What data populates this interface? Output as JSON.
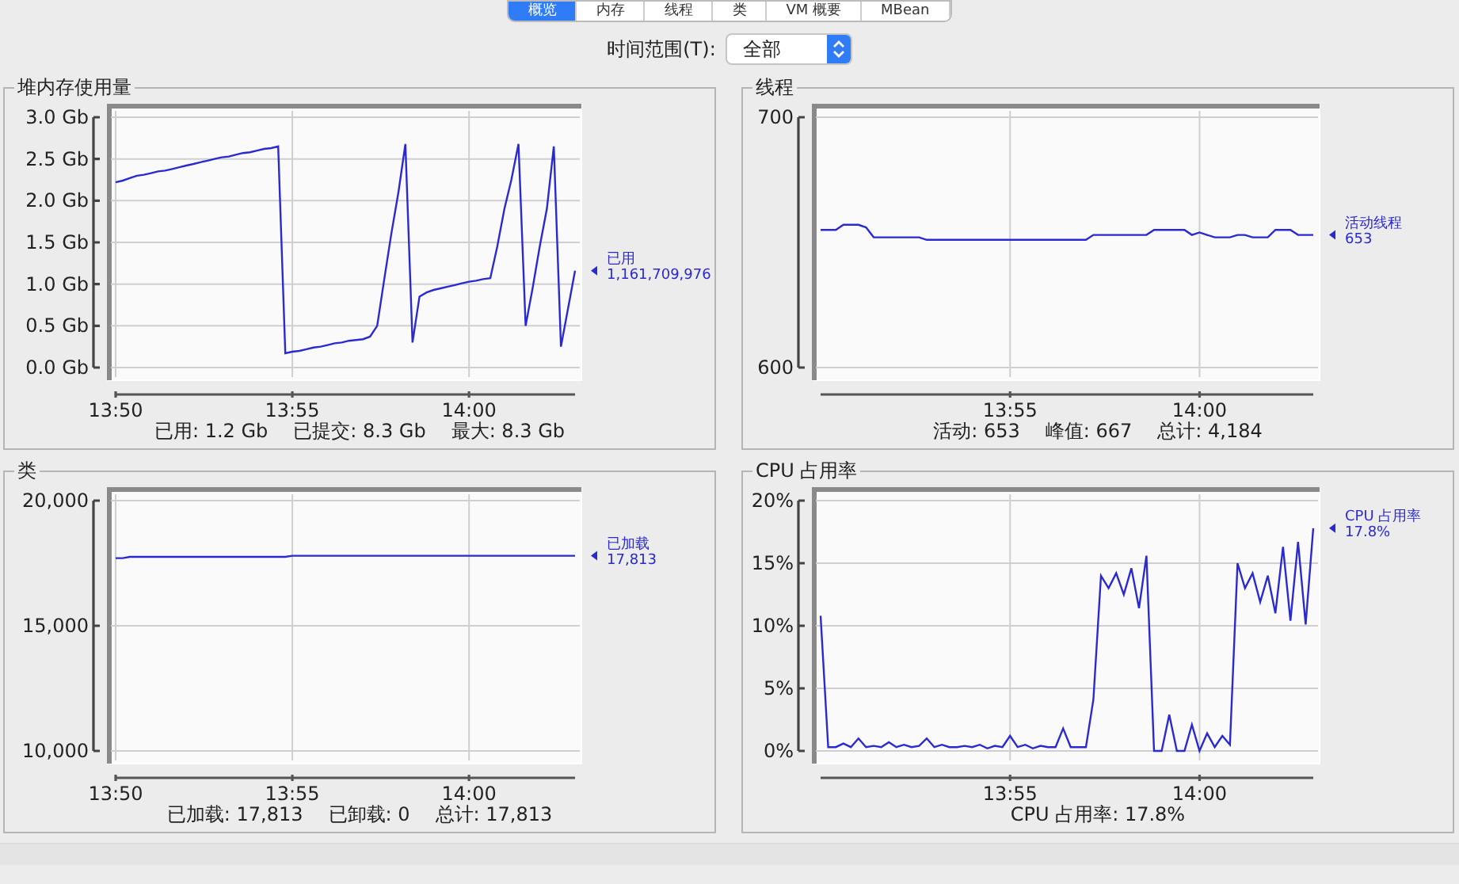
{
  "tabs": [
    {
      "label": "概览",
      "selected": true
    },
    {
      "label": "内存",
      "selected": false
    },
    {
      "label": "线程",
      "selected": false
    },
    {
      "label": "类",
      "selected": false
    },
    {
      "label": "VM 概要",
      "selected": false
    },
    {
      "label": "MBean",
      "selected": false
    }
  ],
  "time_range": {
    "label": "时间范围(T):",
    "value": "全部"
  },
  "panels": [
    {
      "title": "堆内存使用量",
      "legend": {
        "value": "1,161,709,976"
      },
      "summary": [
        "已用: 1.2 Gb",
        "已提交: 8.3 Gb",
        "最大: 8.3 Gb"
      ],
      "chart_data": {
        "type": "line",
        "categories": [
          "13:50",
          null,
          null,
          null,
          null,
          null,
          null,
          null,
          null,
          null,
          null,
          null,
          null,
          null,
          null,
          null,
          null,
          null,
          null,
          null,
          null,
          null,
          null,
          null,
          null,
          "13:55",
          null,
          null,
          null,
          null,
          null,
          null,
          null,
          null,
          null,
          null,
          null,
          null,
          null,
          null,
          null,
          null,
          null,
          null,
          null,
          null,
          null,
          null,
          null,
          null,
          "14:00",
          null,
          null,
          null,
          null,
          null,
          null,
          null,
          null,
          null,
          null,
          null,
          null,
          null,
          null,
          null
        ],
        "series": [
          {
            "name": "已用",
            "color": "#2a2ad0",
            "values": [
              2.22,
              2.24,
              2.27,
              2.3,
              2.31,
              2.33,
              2.35,
              2.36,
              2.38,
              2.4,
              2.42,
              2.44,
              2.46,
              2.48,
              2.5,
              2.52,
              2.53,
              2.55,
              2.57,
              2.58,
              2.6,
              2.62,
              2.63,
              2.65,
              0.17,
              0.19,
              0.2,
              0.22,
              0.24,
              0.25,
              0.27,
              0.29,
              0.3,
              0.32,
              0.33,
              0.34,
              0.37,
              0.5,
              1.05,
              1.6,
              2.1,
              2.68,
              0.3,
              0.85,
              0.9,
              0.93,
              0.95,
              0.97,
              0.99,
              1.01,
              1.03,
              1.04,
              1.06,
              1.07,
              1.45,
              1.9,
              2.25,
              2.68,
              0.5,
              0.95,
              1.45,
              1.9,
              2.65,
              0.25,
              0.7,
              1.16
            ]
          }
        ],
        "ylim": [
          0,
          3
        ],
        "grid": true,
        "yticks": [
          {
            "value": 0,
            "label": "0.0 Gb"
          },
          {
            "value": 0.5,
            "label": "0.5 Gb"
          },
          {
            "value": 1,
            "label": "1.0 Gb"
          },
          {
            "value": 1.5,
            "label": "1.5 Gb"
          },
          {
            "value": 2,
            "label": "2.0 Gb"
          },
          {
            "value": 2.5,
            "label": "2.5 Gb"
          },
          {
            "value": 3,
            "label": "3.0 Gb"
          }
        ]
      }
    },
    {
      "title": "线程",
      "legend": {
        "value": "653"
      },
      "summary": [
        "活动: 653",
        "峰值: 667",
        "总计: 4,184"
      ],
      "chart_data": {
        "type": "line",
        "categories": [
          null,
          null,
          null,
          null,
          null,
          null,
          null,
          null,
          null,
          null,
          null,
          null,
          null,
          null,
          null,
          null,
          null,
          null,
          null,
          null,
          null,
          null,
          null,
          null,
          null,
          "13:55",
          null,
          null,
          null,
          null,
          null,
          null,
          null,
          null,
          null,
          null,
          null,
          null,
          null,
          null,
          null,
          null,
          null,
          null,
          null,
          null,
          null,
          null,
          null,
          null,
          "14:00",
          null,
          null,
          null,
          null,
          null,
          null,
          null,
          null,
          null,
          null,
          null,
          null,
          null,
          null,
          null
        ],
        "series": [
          {
            "name": "活动线程",
            "color": "#2a2ad0",
            "values": [
              655,
              655,
              655,
              657,
              657,
              657,
              656,
              652,
              652,
              652,
              652,
              652,
              652,
              652,
              651,
              651,
              651,
              651,
              651,
              651,
              651,
              651,
              651,
              651,
              651,
              651,
              651,
              651,
              651,
              651,
              651,
              651,
              651,
              651,
              651,
              651,
              653,
              653,
              653,
              653,
              653,
              653,
              653,
              653,
              655,
              655,
              655,
              655,
              655,
              653,
              654,
              653,
              652,
              652,
              652,
              653,
              653,
              652,
              652,
              652,
              655,
              655,
              655,
              653,
              653,
              653
            ]
          }
        ],
        "ylim": [
          600,
          700
        ],
        "grid": true,
        "yticks": [
          {
            "value": 600,
            "label": "600"
          },
          {
            "value": 700,
            "label": "700"
          }
        ]
      }
    },
    {
      "title": "类",
      "legend": {
        "value": "17,813"
      },
      "summary": [
        "已加载: 17,813",
        "已卸载: 0",
        "总计: 17,813"
      ],
      "chart_data": {
        "type": "line",
        "categories": [
          "13:50",
          null,
          null,
          null,
          null,
          null,
          null,
          null,
          null,
          null,
          null,
          null,
          null,
          null,
          null,
          null,
          null,
          null,
          null,
          null,
          null,
          null,
          null,
          null,
          null,
          "13:55",
          null,
          null,
          null,
          null,
          null,
          null,
          null,
          null,
          null,
          null,
          null,
          null,
          null,
          null,
          null,
          null,
          null,
          null,
          null,
          null,
          null,
          null,
          null,
          null,
          "14:00",
          null,
          null,
          null,
          null,
          null,
          null,
          null,
          null,
          null,
          null,
          null,
          null,
          null,
          null,
          null
        ],
        "series": [
          {
            "name": "已加载",
            "color": "#2a2ad0",
            "values": [
              17700,
              17700,
              17750,
              17750,
              17750,
              17750,
              17750,
              17750,
              17750,
              17750,
              17750,
              17750,
              17750,
              17750,
              17750,
              17750,
              17750,
              17750,
              17750,
              17750,
              17750,
              17750,
              17750,
              17750,
              17750,
              17800,
              17800,
              17800,
              17800,
              17800,
              17800,
              17800,
              17800,
              17800,
              17800,
              17800,
              17800,
              17800,
              17800,
              17800,
              17800,
              17800,
              17800,
              17800,
              17800,
              17800,
              17800,
              17800,
              17800,
              17800,
              17800,
              17800,
              17800,
              17800,
              17800,
              17800,
              17800,
              17800,
              17800,
              17800,
              17800,
              17800,
              17800,
              17800,
              17800,
              17800
            ]
          }
        ],
        "ylim": [
          10000,
          20000
        ],
        "grid": true,
        "yticks": [
          {
            "value": 10000,
            "label": "10,000"
          },
          {
            "value": 15000,
            "label": "15,000"
          },
          {
            "value": 20000,
            "label": "20,000"
          }
        ]
      }
    },
    {
      "title": "CPU 占用率",
      "legend": {
        "value": "17.8%"
      },
      "summary": [
        "CPU 占用率: 17.8%"
      ],
      "chart_data": {
        "type": "line",
        "categories": [
          null,
          null,
          null,
          null,
          null,
          null,
          null,
          null,
          null,
          null,
          null,
          null,
          null,
          null,
          null,
          null,
          null,
          null,
          null,
          null,
          null,
          null,
          null,
          null,
          null,
          "13:55",
          null,
          null,
          null,
          null,
          null,
          null,
          null,
          null,
          null,
          null,
          null,
          null,
          null,
          null,
          null,
          null,
          null,
          null,
          null,
          null,
          null,
          null,
          null,
          null,
          "14:00",
          null,
          null,
          null,
          null,
          null,
          null,
          null,
          null,
          null,
          null,
          null,
          null,
          null,
          null,
          null
        ],
        "series": [
          {
            "name": "CPU 占用率",
            "color": "#2a2ad0",
            "values": [
              10.8,
              0.3,
              0.3,
              0.6,
              0.3,
              1.0,
              0.3,
              0.4,
              0.3,
              0.7,
              0.3,
              0.5,
              0.3,
              0.4,
              1.0,
              0.3,
              0.5,
              0.3,
              0.3,
              0.4,
              0.3,
              0.5,
              0.2,
              0.4,
              0.3,
              1.2,
              0.3,
              0.5,
              0.2,
              0.4,
              0.3,
              0.3,
              1.8,
              0.3,
              0.3,
              0.3,
              4.1,
              14.0,
              13.0,
              14.2,
              12.5,
              14.6,
              11.4,
              15.6,
              0,
              0,
              2.9,
              0,
              0,
              2.1,
              0,
              1.4,
              0.3,
              1.2,
              0.5,
              15.0,
              13.0,
              14.2,
              11.9,
              14.0,
              11.0,
              16.3,
              10.4,
              16.7,
              10.1,
              17.8
            ]
          }
        ],
        "ylim": [
          0,
          20
        ],
        "grid": true,
        "yticks": [
          {
            "value": 0,
            "label": "0%"
          },
          {
            "value": 5,
            "label": "5%"
          },
          {
            "value": 10,
            "label": "10%"
          },
          {
            "value": 15,
            "label": "15%"
          },
          {
            "value": 20,
            "label": "20%"
          }
        ]
      }
    }
  ]
}
